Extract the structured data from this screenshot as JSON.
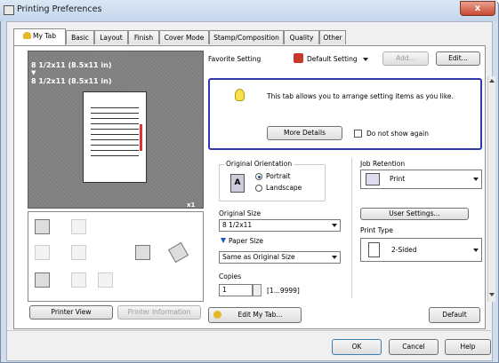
{
  "window": {
    "title": "Printing Preferences",
    "close_label": "x"
  },
  "tabs": [
    {
      "label": "My Tab",
      "active": true
    },
    {
      "label": "Basic",
      "active": false
    },
    {
      "label": "Layout",
      "active": false
    },
    {
      "label": "Finish",
      "active": false
    },
    {
      "label": "Cover Mode",
      "active": false
    },
    {
      "label": "Stamp/Composition",
      "active": false
    },
    {
      "label": "Quality",
      "active": false
    },
    {
      "label": "Other",
      "active": false
    }
  ],
  "preview": {
    "line1": "8 1/2x11 (8.5x11 in)",
    "arrow": "▼",
    "line2": "8 1/2x11 (8.5x11 in)",
    "copies_badge": "x1"
  },
  "left_buttons": {
    "printer_view": "Printer View",
    "printer_information": "Printer Information"
  },
  "favorite": {
    "label": "Favorite Setting",
    "value": "Default Setting",
    "add": "Add...",
    "edit": "Edit..."
  },
  "info": {
    "message": "This tab allows you to arrange setting items as you like.",
    "more_details": "More Details",
    "dont_show": "Do not show again",
    "dont_show_checked": false
  },
  "orientation": {
    "label": "Original Orientation",
    "options": [
      "Portrait",
      "Landscape"
    ],
    "selected": "Portrait"
  },
  "original_size": {
    "label": "Original Size",
    "value": "8 1/2x11"
  },
  "paper_size": {
    "label": "Paper Size",
    "value": "Same as Original Size"
  },
  "copies": {
    "label": "Copies",
    "value": "1",
    "range": "[1...9999]"
  },
  "job_retention": {
    "label": "Job Retention",
    "value": "Print",
    "user_settings": "User Settings..."
  },
  "print_type": {
    "label": "Print Type",
    "value": "2-Sided"
  },
  "bottom": {
    "edit_my_tab": "Edit My Tab...",
    "default": "Default"
  },
  "dialog": {
    "ok": "OK",
    "cancel": "Cancel",
    "help": "Help"
  }
}
